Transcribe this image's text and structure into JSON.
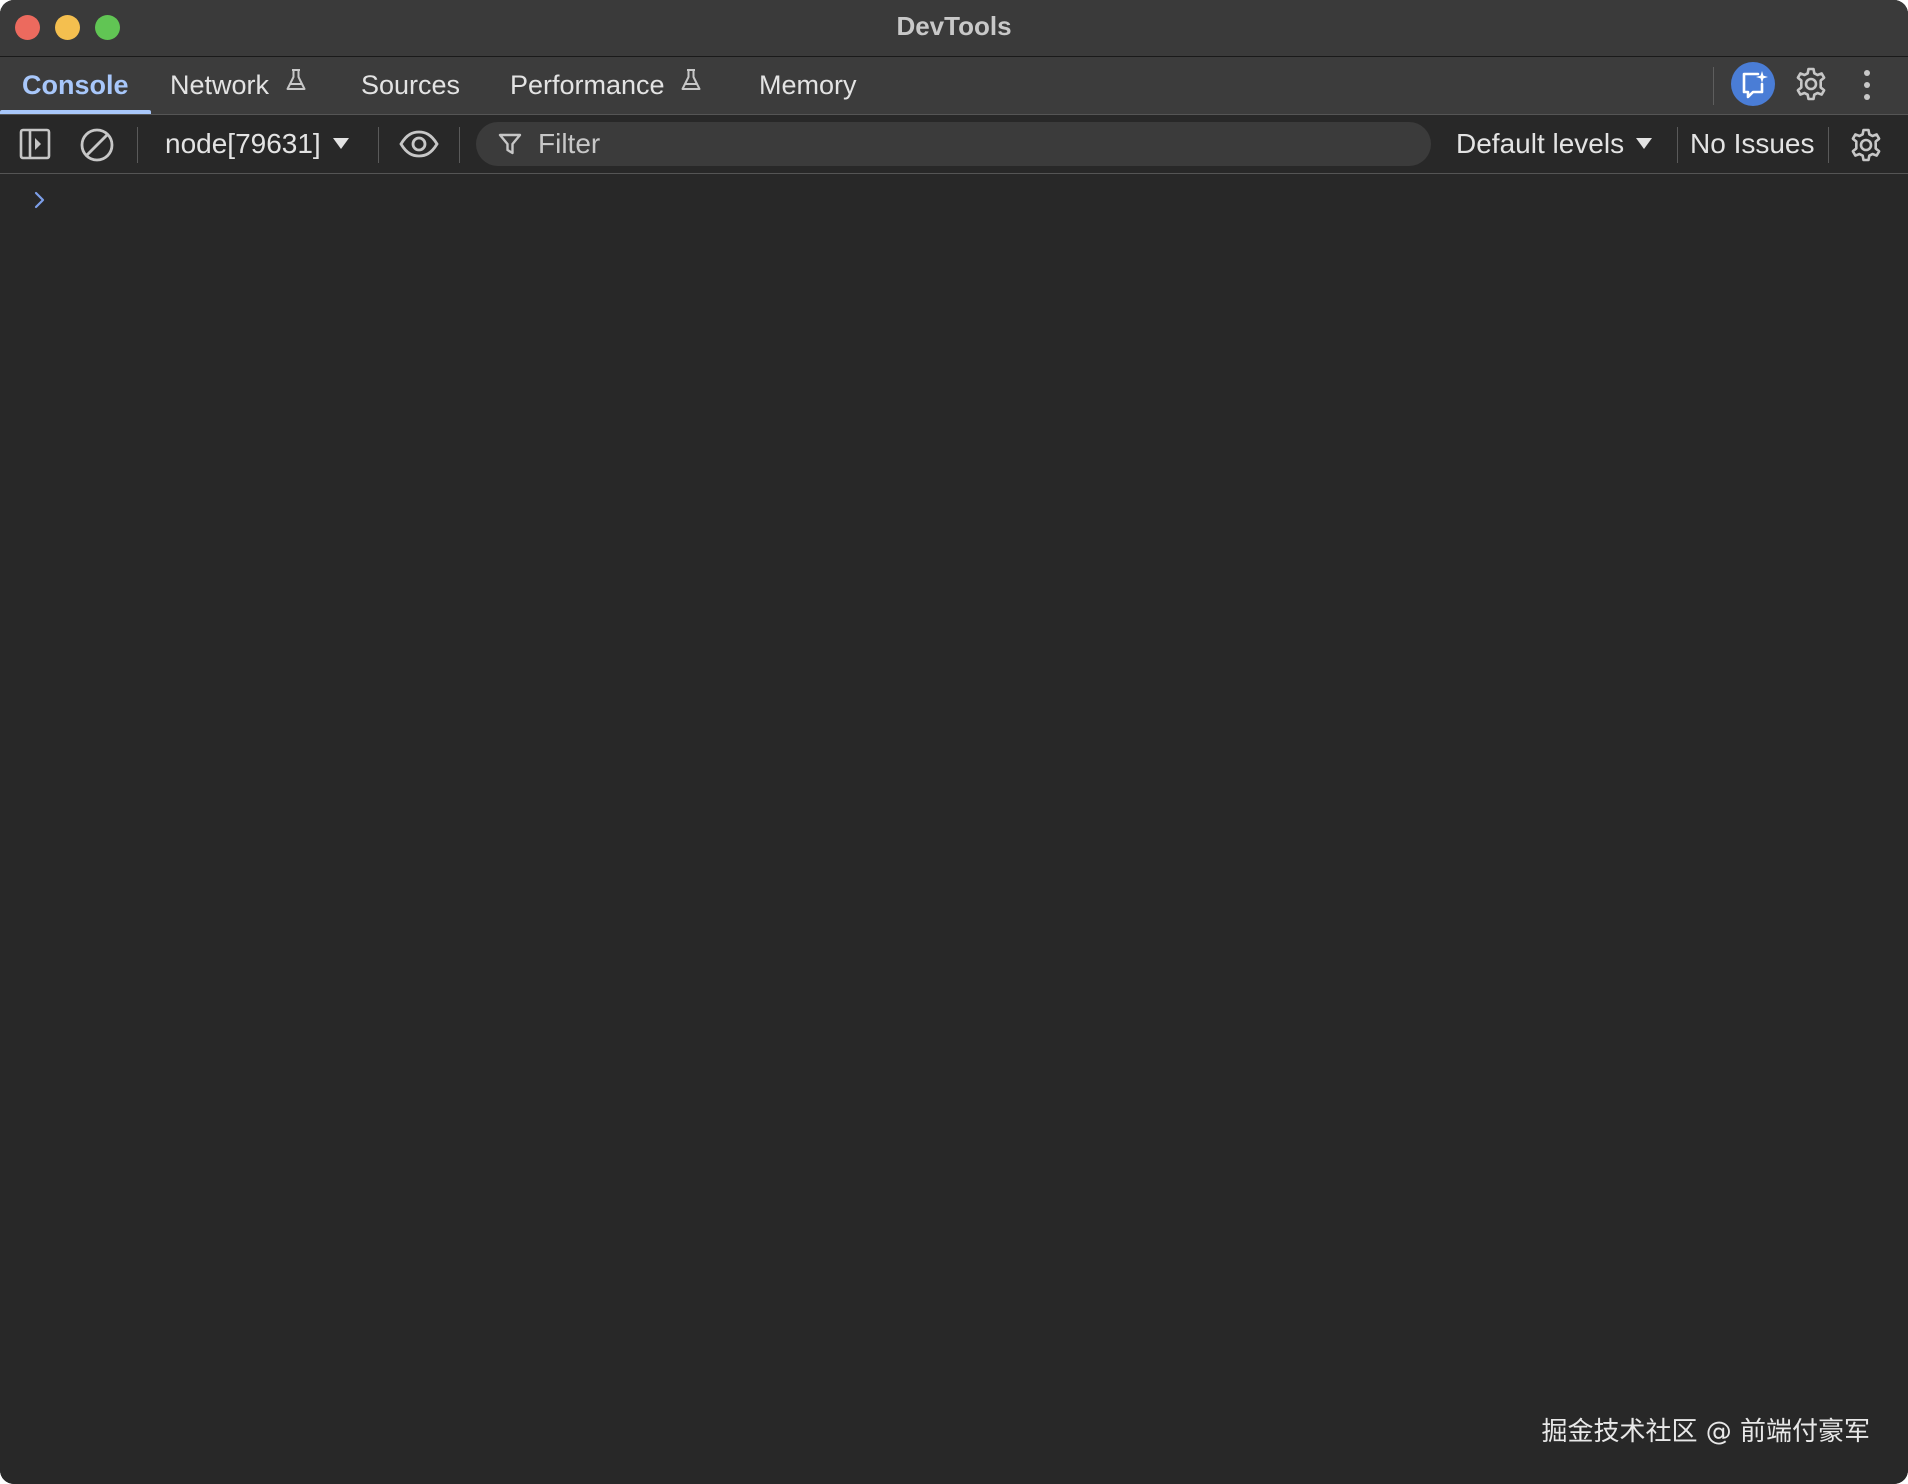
{
  "window": {
    "title": "DevTools"
  },
  "tabs": [
    {
      "label": "Console",
      "active": true,
      "experimental": false
    },
    {
      "label": "Network",
      "active": false,
      "experimental": true
    },
    {
      "label": "Sources",
      "active": false,
      "experimental": false
    },
    {
      "label": "Performance",
      "active": false,
      "experimental": true
    },
    {
      "label": "Memory",
      "active": false,
      "experimental": false
    }
  ],
  "toolbar": {
    "context": "node[79631]",
    "filter_placeholder": "Filter",
    "levels": "Default levels",
    "issues": "No Issues"
  },
  "console": {
    "prompt": ">"
  },
  "watermark": "掘金技术社区 @ 前端付豪军",
  "colors": {
    "accent": "#a8c7fa",
    "background": "#282828",
    "ai_button": "#4a7dd6"
  },
  "icons": [
    "sidebar-toggle-icon",
    "clear-console-icon",
    "eye-icon",
    "filter-icon",
    "gear-icon",
    "kebab-menu-icon",
    "ai-assistance-icon",
    "flask-icon",
    "prompt-chevron-icon"
  ]
}
